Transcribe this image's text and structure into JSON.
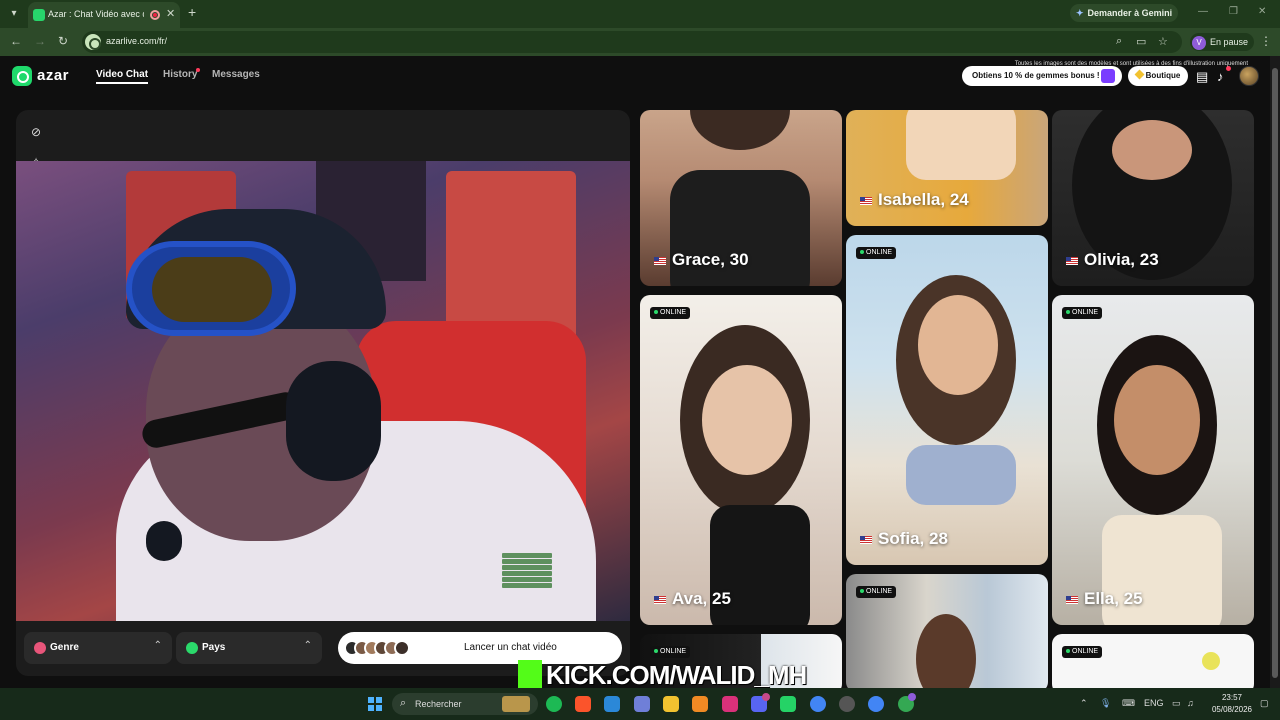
{
  "browser": {
    "tab_title": "Azar : Chat Vidéo avec de n",
    "gemini_label": "Demander à Gemini",
    "url": "azarlive.com/fr/",
    "profile_initial": "V",
    "profile_status": "En pause"
  },
  "site": {
    "brand": "azar",
    "nav": [
      "Video Chat",
      "History",
      "Messages"
    ],
    "promo": "Obtiens 10 % de gemmes bonus !",
    "boutique": "Boutique",
    "disclaimer": "Toutes les images sont des modèles et sont utilisées à des fins d'illustration uniquement",
    "filters": {
      "genre": "Genre",
      "pays": "Pays"
    },
    "start_label": "Lancer un chat vidéo",
    "online_label": "ONLINE",
    "profiles": [
      {
        "name": "Grace, 30"
      },
      {
        "name": "Isabella, 24"
      },
      {
        "name": "Olivia, 23"
      },
      {
        "name": "Ava, 25"
      },
      {
        "name": "Sofia, 28"
      },
      {
        "name": "Ella, 25"
      }
    ]
  },
  "overlay": {
    "kick": "KICK.COM/WALID_MH"
  },
  "taskbar": {
    "search": "Rechercher",
    "lang": "ENG",
    "time": "23:57",
    "date": "05/08/2026"
  },
  "colors": {
    "accent": "#1fd96b",
    "online": "#2bd96b",
    "kick": "#53fc18"
  }
}
